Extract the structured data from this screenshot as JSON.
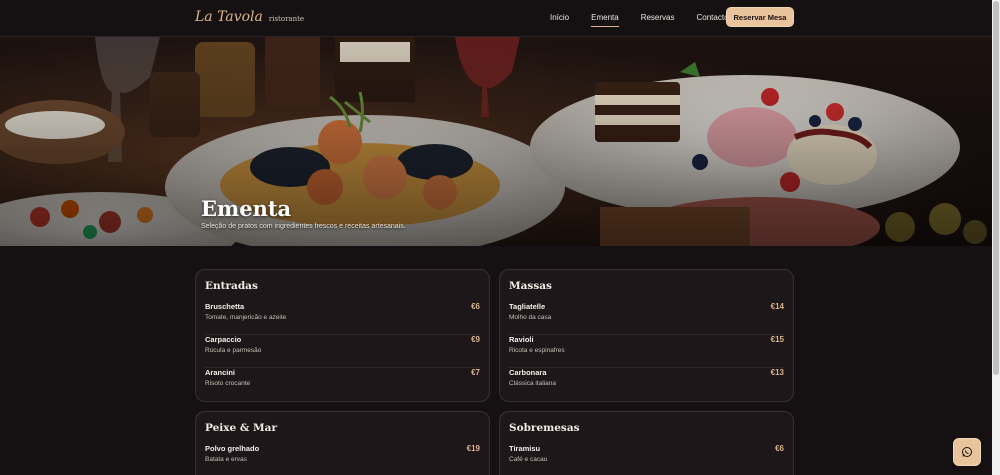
{
  "nav": {
    "brand_name": "La Tavola",
    "brand_sub": "ristorante",
    "links": [
      "Início",
      "Ementa",
      "Reservas",
      "Contactos"
    ],
    "active": "Ementa",
    "reserve_label": "Reservar Mesa"
  },
  "hero": {
    "title": "Ementa",
    "subtitle": "Seleção de pratos com ingredientes frescos e receitas artesanais."
  },
  "sections": [
    {
      "title": "Entradas",
      "items": [
        {
          "name": "Bruschetta",
          "desc": "Tomate, manjericão e azeite",
          "price": "€6"
        },
        {
          "name": "Carpaccio",
          "desc": "Rúcula e parmesão",
          "price": "€9"
        },
        {
          "name": "Arancini",
          "desc": "Risoto crocante",
          "price": "€7"
        }
      ]
    },
    {
      "title": "Massas",
      "items": [
        {
          "name": "Tagliatelle",
          "desc": "Molho da casa",
          "price": "€14"
        },
        {
          "name": "Ravioli",
          "desc": "Ricota e espinafres",
          "price": "€15"
        },
        {
          "name": "Carbonara",
          "desc": "Clássica italiana",
          "price": "€13"
        }
      ]
    },
    {
      "title": "Peixe & Mar",
      "items": [
        {
          "name": "Polvo grelhado",
          "desc": "Batata e ervas",
          "price": "€19"
        }
      ]
    },
    {
      "title": "Sobremesas",
      "items": [
        {
          "name": "Tiramisu",
          "desc": "Café e cacau",
          "price": "€6"
        }
      ]
    }
  ],
  "fab_icon": "whatsapp-icon"
}
